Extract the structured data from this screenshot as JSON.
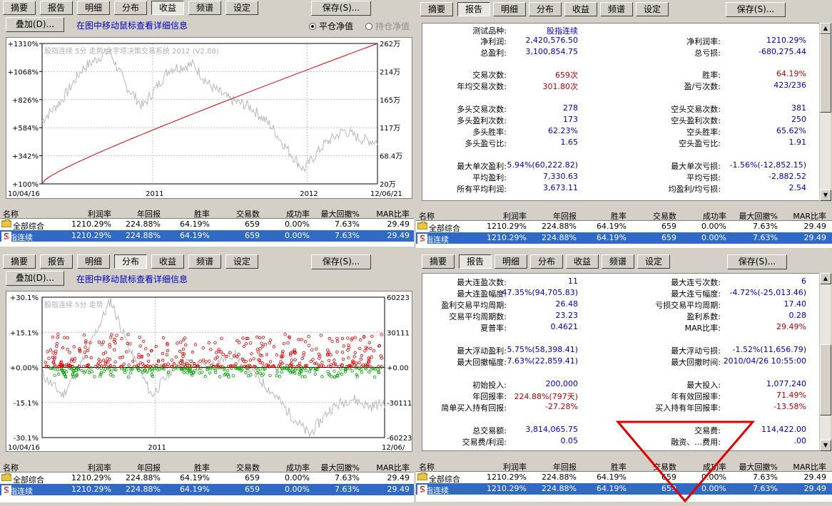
{
  "tabs": [
    "摘要",
    "报告",
    "明细",
    "分布",
    "收益",
    "频谱",
    "设定"
  ],
  "save_btn": "保存(S)...",
  "overlay_btn": "叠加(D)...",
  "hint": "在图中移动鼠标查看详细信息",
  "radio": {
    "option1": "平仓净值",
    "option2": "持仓净值"
  },
  "table": {
    "headers": [
      "名称",
      "利润率",
      "年回报",
      "胜率",
      "交易数",
      "成功率",
      "最大回撤%",
      "MAR比率"
    ],
    "rows": [
      {
        "name": "全部综合",
        "cells": [
          "1210.29%",
          "224.88%",
          "64.19%",
          "659",
          "0.00%",
          "7.63%",
          "29.49"
        ]
      },
      {
        "name": "股指连续",
        "cells": [
          "1210.29%",
          "224.88%",
          "64.19%",
          "659",
          "0.00%",
          "7.63%",
          "29.49"
        ]
      }
    ]
  },
  "equity_chart": {
    "watermark": "股指连续 5分 走势    金字塔决策交易系统 2012 (V2.88)",
    "left_ticks": [
      "+1310%",
      "+1068%",
      "+826%",
      "+584%",
      "+342%",
      "+100%"
    ],
    "right_ticks": [
      "262万",
      "214万",
      "165万",
      "117万",
      "68.4万",
      "20万"
    ],
    "x_ticks": [
      "10/04/16",
      "2011",
      "2012",
      "12/06/21"
    ]
  },
  "dist_chart": {
    "watermark": "股指连续 5分 走势",
    "left_ticks": [
      "+30.1%",
      "+15.1%",
      "+0.00%",
      "-15.1%",
      "-30.1%"
    ],
    "right_ticks": [
      "60223",
      "30111",
      "+0.00",
      "-30111",
      "-60223"
    ],
    "x_ticks": [
      "10/04/16",
      "2011",
      "12/06/"
    ]
  },
  "chart_data": [
    {
      "type": "line",
      "series": [
        {
          "values": [
            100,
            1310
          ]
        }
      ],
      "ylim": [
        100,
        1310
      ],
      "grid": true
    },
    {
      "type": "scatter",
      "ylim": [
        -30.1,
        30.1
      ],
      "grid": true
    }
  ],
  "report_top": [
    {
      "l": "测试品种:",
      "v": "股指连续",
      "vc": "blue"
    },
    {
      "l": "净利润:",
      "v": "2,420,576.50",
      "vc": "blue",
      "l2": "净利润率:",
      "v2": "1210.29%",
      "v2c": "blue"
    },
    {
      "l": "总盈利:",
      "v": "3,100,854.75",
      "vc": "blue",
      "l2": "总亏损:",
      "v2": "-680,275.44",
      "v2c": "blue"
    },
    {
      "l": "交易次数:",
      "v": "659次",
      "vc": "red",
      "l2": "胜率:",
      "v2": "64.19%",
      "v2c": "red"
    },
    {
      "l": "年均交易次数:",
      "v": "301.80次",
      "vc": "red",
      "l2": "盈/亏次数:",
      "v2": "423/236",
      "v2c": "blue"
    },
    {
      "l": "多头交易次数:",
      "v": "278",
      "vc": "blue",
      "l2": "空头交易次数:",
      "v2": "381",
      "v2c": "blue"
    },
    {
      "l": "多头盈利次数:",
      "v": "173",
      "vc": "blue",
      "l2": "空头盈利次数:",
      "v2": "250",
      "v2c": "blue"
    },
    {
      "l": "多头胜率:",
      "v": "62.23%",
      "vc": "blue",
      "l2": "空头胜率:",
      "v2": "65.62%",
      "v2c": "blue"
    },
    {
      "l": "多头盈亏比:",
      "v": "1.65",
      "vc": "blue",
      "l2": "空头盈亏比:",
      "v2": "1.91",
      "v2c": "blue"
    },
    {
      "l": "最大单次盈利:",
      "v": "5.94%(60,222.82)",
      "vc": "blue",
      "l2": "最大单次亏损:",
      "v2": "-1.56%(-12,852.15)",
      "v2c": "blue"
    },
    {
      "l": "平均盈利:",
      "v": "7,330.63",
      "vc": "blue",
      "l2": "平均亏损:",
      "v2": "-2,882.52",
      "v2c": "blue"
    },
    {
      "l": "所有平均利润:",
      "v": "3,673.11",
      "vc": "blue",
      "l2": "均盈利/均亏损:",
      "v2": "2.54",
      "v2c": "blue"
    }
  ],
  "report_bottom": [
    {
      "l": "最大连盈次数:",
      "v": "11",
      "vc": "blue",
      "l2": "最大连亏次数:",
      "v2": "6",
      "v2c": "blue"
    },
    {
      "l": "最大连盈幅度:",
      "v": "47.35%(94,705.83)",
      "vc": "blue",
      "l2": "最大连亏幅度:",
      "v2": "-4.72%(-25,013.46)",
      "v2c": "blue"
    },
    {
      "l": "盈利交易平均周期:",
      "v": "26.48",
      "vc": "blue",
      "l2": "亏损交易平均周期:",
      "v2": "17.40",
      "v2c": "blue"
    },
    {
      "l": "交易平均周期数:",
      "v": "23.23",
      "vc": "blue",
      "l2": "盈利系数:",
      "v2": "0.28",
      "v2c": "blue"
    },
    {
      "l": "夏普率:",
      "v": "0.4621",
      "vc": "blue",
      "l2": "MAR比率:",
      "v2": "29.49%",
      "v2c": "red"
    },
    {
      "l": "最大浮动盈利:",
      "v": "5.75%(58,398.41)",
      "vc": "blue",
      "l2": "最大浮动亏损:",
      "v2": "-1.52%(11,656.79)",
      "v2c": "blue"
    },
    {
      "l": "最大回撤幅度:",
      "v": "7.63%(22,859.41)",
      "vc": "blue",
      "l2": "最大回撤时间:",
      "v2": "2010/04/26 10:55:00",
      "v2c": "blue"
    },
    {
      "l": "初始投入:",
      "v": "200,000",
      "vc": "blue",
      "l2": "最大投入:",
      "v2": "1,077,240",
      "v2c": "blue"
    },
    {
      "l": "年回报率:",
      "v": "224.88%(797天)",
      "vc": "red",
      "l2": "年有效回报率:",
      "v2": "71.49%",
      "v2c": "red"
    },
    {
      "l": "简单买入持有回报:",
      "v": "-27.28%",
      "vc": "red",
      "l2": "买入持有年回报率:",
      "v2": "-13.58%",
      "v2c": "red"
    },
    {
      "l": "总交易额:",
      "v": "3,814,065.75",
      "vc": "blue",
      "l2": "交易费:",
      "v2": "114,422.00",
      "v2c": "blue"
    },
    {
      "l": "交易费/利润:",
      "v": "0.05",
      "vc": "blue",
      "l2": "融资、…费用:",
      "v2": ".00",
      "v2c": "blue"
    }
  ]
}
